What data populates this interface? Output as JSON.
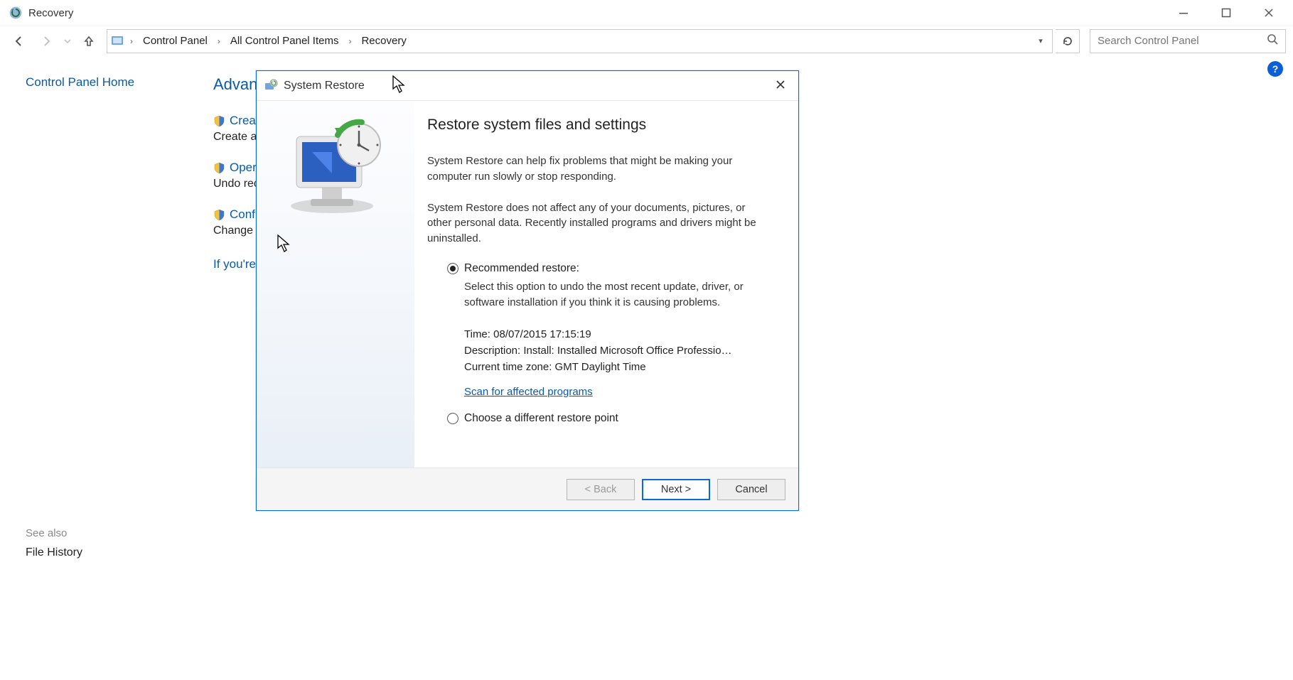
{
  "window": {
    "title": "Recovery"
  },
  "breadcrumb": {
    "root": "Control Panel",
    "mid": "All Control Panel Items",
    "leaf": "Recovery"
  },
  "search": {
    "placeholder": "Search Control Panel"
  },
  "sidebar": {
    "home": "Control Panel Home",
    "see_also_label": "See also",
    "see_also_link": "File History"
  },
  "main": {
    "heading": "Advan",
    "actions": {
      "create": {
        "link": "Creat",
        "desc": "Create a"
      },
      "open": {
        "link": "Oper",
        "desc": "Undo rec"
      },
      "conf": {
        "link": "Conf",
        "desc": "Change"
      }
    },
    "also_link": "If you're"
  },
  "dialog": {
    "title": "System Restore",
    "heading": "Restore system files and settings",
    "p1": "System Restore can help fix problems that might be making your computer run slowly or stop responding.",
    "p2": "System Restore does not affect any of your documents, pictures, or other personal data. Recently installed programs and drivers might be uninstalled.",
    "radio1_label": "Recommended restore:",
    "radio1_sub": "Select this option to undo the most recent update, driver, or software installation if you think it is causing problems.",
    "time_line": "Time: 08/07/2015 17:15:19",
    "desc_line": "Description: Install: Installed Microsoft Office Professio…",
    "tz_line": "Current time zone: GMT Daylight Time",
    "scan_link": "Scan for affected programs",
    "radio2_label": "Choose a different restore point",
    "buttons": {
      "back": "< Back",
      "next": "Next >",
      "cancel": "Cancel"
    }
  }
}
